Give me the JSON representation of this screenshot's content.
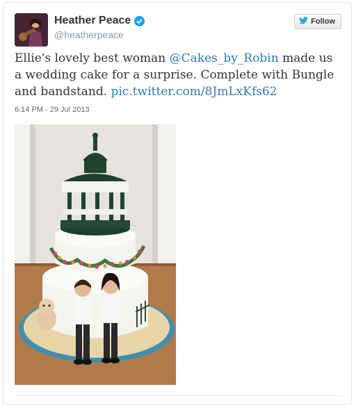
{
  "user": {
    "display_name": "Heather Peace",
    "handle": "@heatherpeace",
    "verified": true
  },
  "follow_button": {
    "label": "Follow",
    "icon": "twitter-bird-icon"
  },
  "tweet": {
    "text_part1": "Ellie's lovely best woman ",
    "mention": "@Cakes_by_Robin",
    "text_part2": " made us a wedding cake for a surprise. Complete with Bungle and bandstand. ",
    "link": "pic.twitter.com/8JmLxKfs62",
    "timestamp": "6:14 PM - 29 Jul 2013"
  },
  "colors": {
    "link": "#2a7bb6",
    "verified": "#1da1f2",
    "text": "#333333",
    "muted": "#8899a6"
  }
}
